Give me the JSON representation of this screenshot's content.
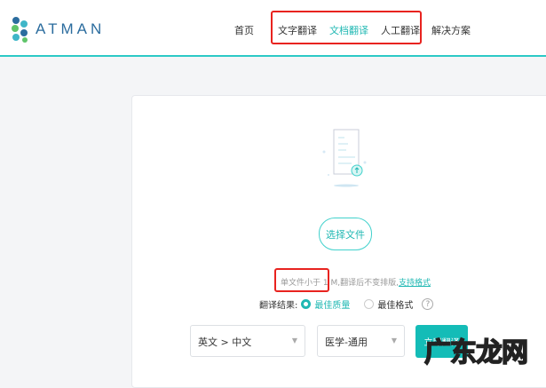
{
  "header": {
    "logo_text": "ATMAN",
    "nav": [
      "首页",
      "文字翻译",
      "文档翻译",
      "人工翻译",
      "解决方案"
    ],
    "active_nav": "文档翻译"
  },
  "upload": {
    "choose_file": "选择文件",
    "note_limit": "单文件小于 1 M,",
    "note_rest": "翻译后不变排版,",
    "supported_formats": "支持格式"
  },
  "result": {
    "label": "翻译结果:",
    "options": [
      "最佳质量",
      "最佳格式"
    ],
    "selected": "最佳质量",
    "help": "?"
  },
  "controls": {
    "language": "英文 > 中文",
    "domain": "医学-通用",
    "translate": "立即翻译"
  },
  "watermark": "广东龙网",
  "colors": {
    "accent": "#20b8b3",
    "highlight": "#e8231f"
  }
}
